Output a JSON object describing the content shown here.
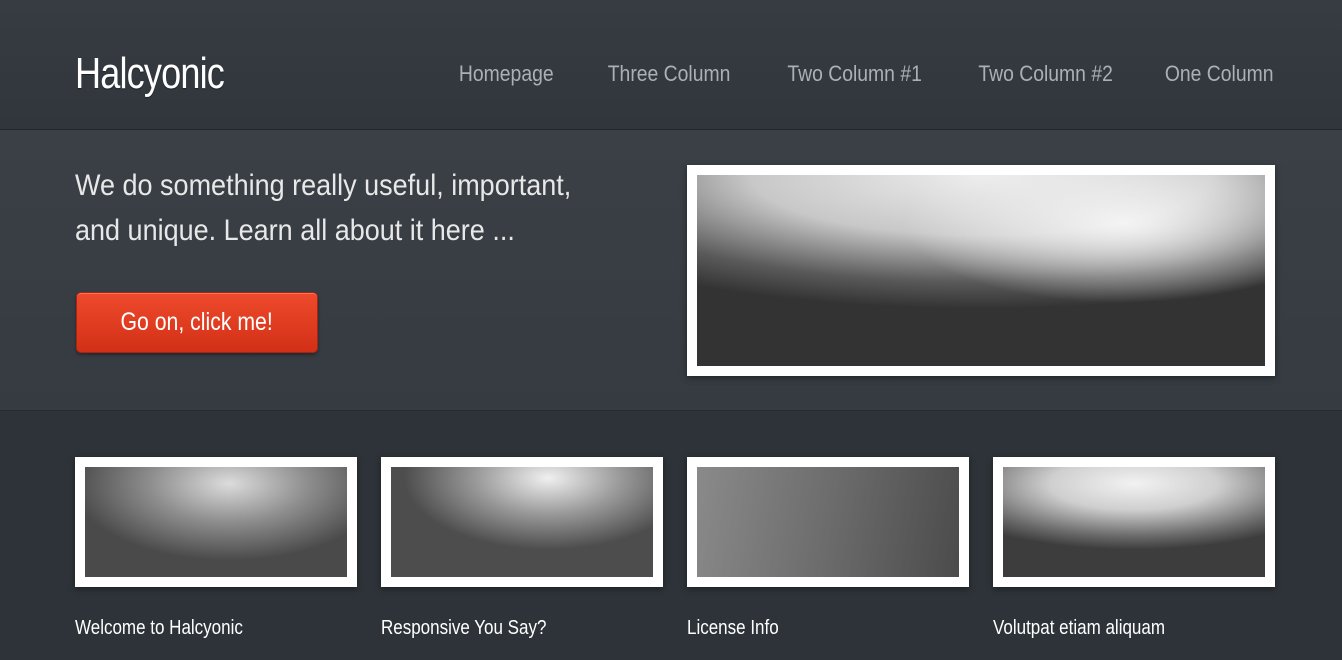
{
  "header": {
    "logo": "Halcyonic",
    "nav": [
      {
        "label": "Homepage"
      },
      {
        "label": "Three Column"
      },
      {
        "label": "Two Column #1"
      },
      {
        "label": "Two Column #2"
      },
      {
        "label": "One Column"
      }
    ]
  },
  "banner": {
    "tagline": "We do something really useful, important, and unique. Learn all about it here ...",
    "cta_label": "Go on, click me!"
  },
  "features": [
    {
      "title": "Welcome to Halcyonic"
    },
    {
      "title": "Responsive You Say?"
    },
    {
      "title": "License Info"
    },
    {
      "title": "Volutpat etiam aliquam"
    }
  ],
  "colors": {
    "background": "#2c3237",
    "accent_button": "#e0391e",
    "text": "#ffffff",
    "nav_text": "#a9b0b6"
  }
}
